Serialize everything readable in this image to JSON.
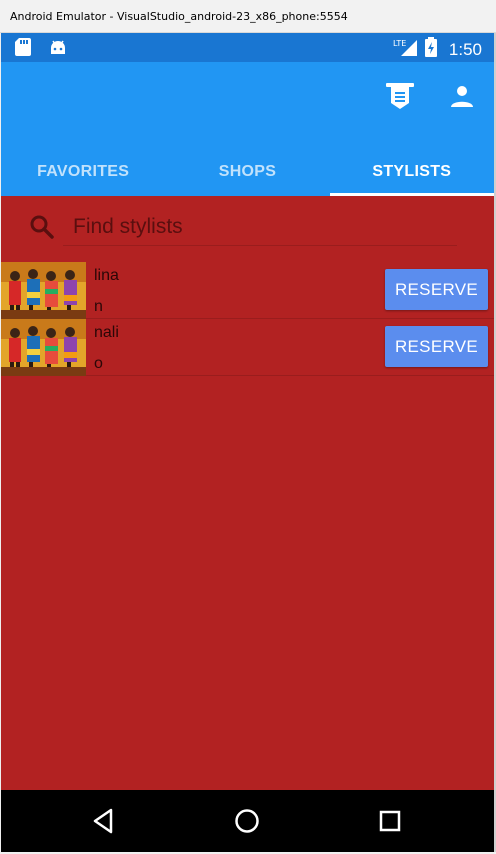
{
  "window": {
    "title": "Android Emulator - VisualStudio_android-23_x86_phone:5554"
  },
  "status_bar": {
    "time": "1:50",
    "network": "LTE",
    "icons": [
      "sd-card-icon",
      "android-icon",
      "signal-icon",
      "battery-icon"
    ]
  },
  "app_bar": {
    "actions": [
      "shop-sign-icon",
      "account-icon"
    ]
  },
  "tabs": [
    {
      "label": "FAVORITES",
      "active": false
    },
    {
      "label": "SHOPS",
      "active": false
    },
    {
      "label": "STYLISTS",
      "active": true
    }
  ],
  "search": {
    "placeholder": "Find stylists",
    "value": ""
  },
  "stylists": [
    {
      "name_line1": "lina",
      "name_line2": "n",
      "button": "RESERVE"
    },
    {
      "name_line1": "nali",
      "name_line2": "o",
      "button": "RESERVE"
    }
  ],
  "nav_bar": {
    "buttons": [
      "back-icon",
      "home-icon",
      "recents-icon"
    ]
  },
  "colors": {
    "app_bar": "#2196f3",
    "status_bar": "#1976d2",
    "content": "#b22222",
    "button": "#5b8dee"
  }
}
